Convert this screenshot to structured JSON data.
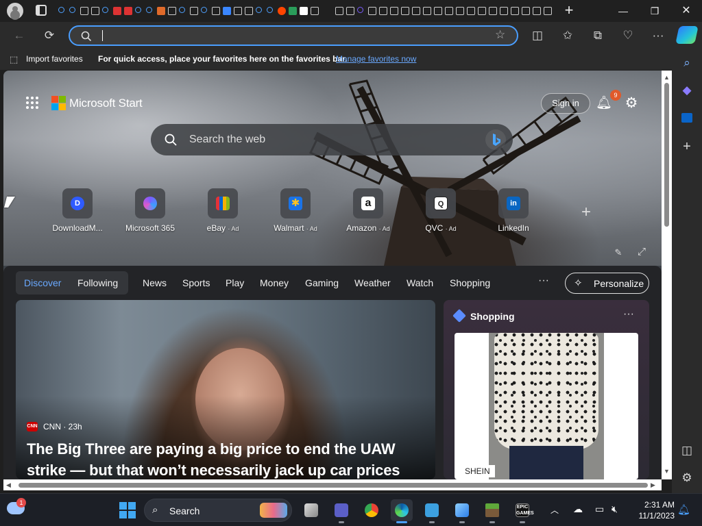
{
  "browser": {
    "address": {
      "value": "",
      "placeholder": ""
    },
    "favorites_bar": {
      "import_label": "Import favorites",
      "hint": "For quick access, place your favorites here on the favorites bar.",
      "manage_link": "Manage favorites now"
    }
  },
  "page": {
    "brand": "Microsoft Start",
    "signin_label": "Sign in",
    "notification_count": "9",
    "search_placeholder": "Search the web",
    "shortcuts": [
      {
        "label": "DownloadM...",
        "ad": "",
        "icon": "D",
        "color": "#2f5bff"
      },
      {
        "label": "Microsoft 365",
        "ad": "",
        "icon": "",
        "color": "#7b5cff"
      },
      {
        "label": "eBay",
        "ad": "· Ad",
        "icon": "",
        "color": "#2b7de9"
      },
      {
        "label": "Walmart",
        "ad": "· Ad",
        "icon": "✱",
        "color": "#1a73e8"
      },
      {
        "label": "Amazon",
        "ad": "· Ad",
        "icon": "a",
        "color": "#111111"
      },
      {
        "label": "QVC",
        "ad": "· Ad",
        "icon": "Q",
        "color": "#ffffff"
      },
      {
        "label": "LinkedIn",
        "ad": "",
        "icon": "in",
        "color": "#0a66c2"
      }
    ],
    "feed_nav": {
      "tabs": [
        "Discover",
        "Following"
      ],
      "links": [
        "News",
        "Sports",
        "Play",
        "Money",
        "Gaming",
        "Weather",
        "Watch",
        "Shopping"
      ],
      "more": "···",
      "personalize": "Personalize"
    },
    "main_card": {
      "source_logo": "CNN",
      "source": "CNN · 23h",
      "headline": "The Big Three are paying a big price to end the UAW strike — but that won’t necessarily jack up car prices"
    },
    "shopping_card": {
      "title": "Shopping",
      "more": "···",
      "brand": "SHEIN"
    }
  },
  "taskbar": {
    "weather_badge": "1",
    "search_placeholder": "Search",
    "time": "2:31 AM",
    "date": "11/1/2023"
  },
  "colors": {
    "accent": "#4a9eff",
    "discover": "#6aa9ff",
    "badge": "#e05a2a"
  }
}
